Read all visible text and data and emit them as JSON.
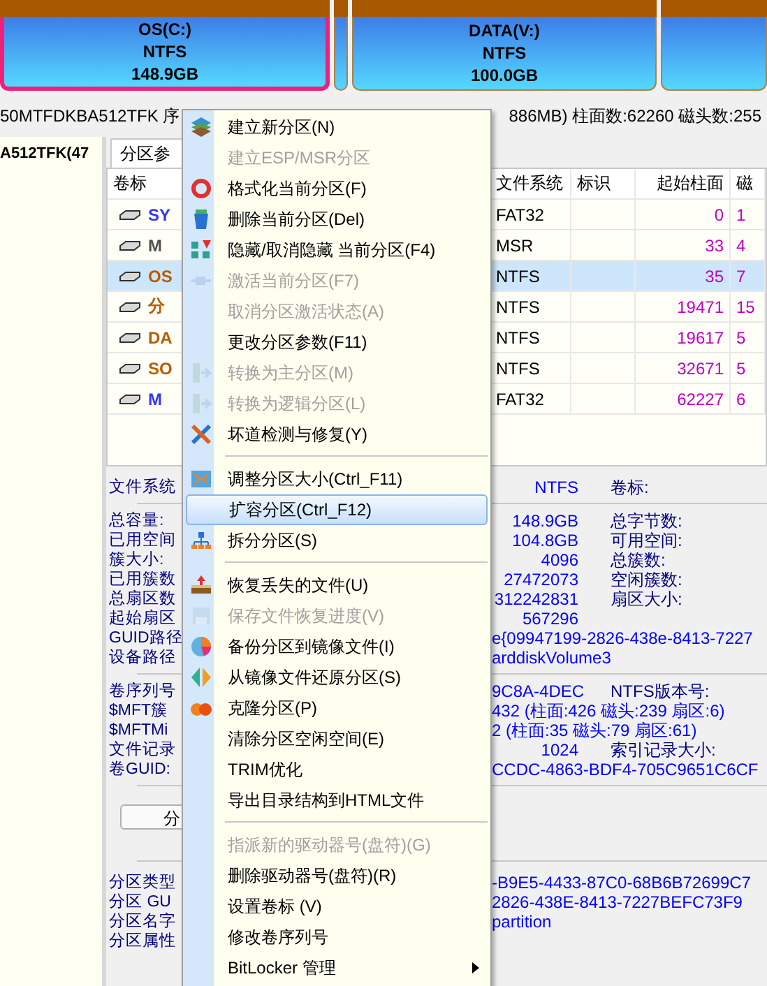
{
  "disk_map": {
    "partitions": [
      {
        "name": "OS(C:)",
        "fs": "NTFS",
        "size": "148.9GB",
        "selected": true,
        "kind": "large"
      },
      {
        "selected": false,
        "kind": "small"
      },
      {
        "name": "DATA(V:)",
        "fs": "NTFS",
        "size": "100.0GB",
        "selected": false,
        "kind": "large"
      },
      {
        "selected": false,
        "kind": "rest"
      }
    ]
  },
  "disk_info": {
    "left": "50MTFDKBA512TFK  序",
    "right": "886MB)  柱面数:62260  磁头数:255"
  },
  "disk_tree": {
    "item": "A512TFK(47"
  },
  "tabs": [
    {
      "label": "分区参",
      "selected": true
    }
  ],
  "table": {
    "columns": [
      "卷标",
      "文件系统",
      "标识",
      "起始柱面",
      "磁"
    ],
    "rows": [
      {
        "label": "SY",
        "color": "#3434ff",
        "fs": "FAT32",
        "start": "0",
        "column_5": "1",
        "selected": false
      },
      {
        "label": "M",
        "color": "#505050",
        "fs": "MSR",
        "start": "33",
        "column_5": "4",
        "selected": false
      },
      {
        "label": "OS",
        "color": "#b85c00",
        "fs": "NTFS",
        "start": "35",
        "column_5": "7",
        "selected": true
      },
      {
        "label": "分",
        "color": "#b85c00",
        "fs": "NTFS",
        "start": "19471",
        "column_5": "15",
        "selected": false
      },
      {
        "label": "DA",
        "color": "#b85c00",
        "fs": "NTFS",
        "start": "19617",
        "column_5": "5",
        "selected": false
      },
      {
        "label": "SO",
        "color": "#b85c00",
        "fs": "NTFS",
        "start": "32671",
        "column_5": "5",
        "selected": false
      },
      {
        "label": "M",
        "color": "#3434ff",
        "fs": "FAT32",
        "start": "62227",
        "column_5": "6",
        "selected": false
      }
    ]
  },
  "details": [
    [
      {
        "kind": "pair",
        "label": "文件系统",
        "value": "NTFS",
        "right_label": "卷标:"
      }
    ],
    [
      {
        "kind": "pair",
        "label": "总容量:",
        "value": "148.9GB",
        "right_label": "总字节数:"
      },
      {
        "kind": "pair",
        "label": "已用空间",
        "value": "104.8GB",
        "right_label": "可用空间:"
      },
      {
        "kind": "pair",
        "label": "簇大小:",
        "value": "4096",
        "right_label": "总簇数:"
      },
      {
        "kind": "pair",
        "label": "已用簇数",
        "value": "27472073",
        "right_label": "空闲簇数:"
      },
      {
        "kind": "pair",
        "label": "总扇区数",
        "value": "312242831",
        "right_label": "扇区大小:"
      },
      {
        "kind": "pair",
        "label": "起始扇区",
        "value": "567296"
      },
      {
        "kind": "long",
        "label": "GUID路径",
        "value": "e{09947199-2826-438e-8413-7227"
      },
      {
        "kind": "long",
        "label": "设备路径",
        "value": "arddiskVolume3"
      }
    ],
    [
      {
        "kind": "pair",
        "label": "卷序列号",
        "value": "9C8A-4DEC",
        "right_label": "NTFS版本号:"
      },
      {
        "kind": "long",
        "label": "$MFT簇",
        "value": "432 (柱面:426 磁头:239 扇区:6)"
      },
      {
        "kind": "long",
        "label": "$MFTMi",
        "value": "2 (柱面:35 磁头:79 扇区:61)"
      },
      {
        "kind": "pair",
        "label": "文件记录",
        "value": "1024",
        "right_label": "索引记录大小:"
      },
      {
        "kind": "long",
        "label": "卷GUID:",
        "value": "CCDC-4863-BDF4-705C9651C6CF"
      }
    ]
  ],
  "analyze_button": "分",
  "partition_info": [
    {
      "label": "分区类型",
      "value": "-B9E5-4433-87C0-68B6B72699C7"
    },
    {
      "label": "分区 GU",
      "value": "2826-438E-8413-7227BEFC73F9"
    },
    {
      "label": "分区名字",
      "value": "partition"
    },
    {
      "label": "分区属性"
    }
  ],
  "context_menu": [
    {
      "kind": "item",
      "label": "建立新分区(N)",
      "disabled": false,
      "selected": false
    },
    {
      "kind": "item",
      "label": "建立ESP/MSR分区",
      "disabled": true,
      "selected": false
    },
    {
      "kind": "item",
      "label": "格式化当前分区(F)",
      "disabled": false,
      "selected": false
    },
    {
      "kind": "item",
      "label": "删除当前分区(Del)",
      "disabled": false,
      "selected": false
    },
    {
      "kind": "item",
      "label": "隐藏/取消隐藏 当前分区(F4)",
      "disabled": false,
      "selected": false
    },
    {
      "kind": "item",
      "label": "激活当前分区(F7)",
      "disabled": true,
      "selected": false
    },
    {
      "kind": "item",
      "label": "取消分区激活状态(A)",
      "disabled": true,
      "selected": false
    },
    {
      "kind": "item",
      "label": "更改分区参数(F11)",
      "disabled": false,
      "selected": false
    },
    {
      "kind": "item",
      "label": "转换为主分区(M)",
      "disabled": true,
      "selected": false
    },
    {
      "kind": "item",
      "label": "转换为逻辑分区(L)",
      "disabled": true,
      "selected": false
    },
    {
      "kind": "item",
      "label": "坏道检测与修复(Y)",
      "disabled": false,
      "selected": false
    },
    {
      "kind": "separator"
    },
    {
      "kind": "item",
      "label": "调整分区大小(Ctrl_F11)",
      "disabled": false,
      "selected": false
    },
    {
      "kind": "item",
      "label": "扩容分区(Ctrl_F12)",
      "disabled": false,
      "selected": true
    },
    {
      "kind": "item",
      "label": "拆分分区(S)",
      "disabled": false,
      "selected": false
    },
    {
      "kind": "separator"
    },
    {
      "kind": "item",
      "label": "恢复丢失的文件(U)",
      "disabled": false,
      "selected": false
    },
    {
      "kind": "item",
      "label": "保存文件恢复进度(V)",
      "disabled": true,
      "selected": false
    },
    {
      "kind": "item",
      "label": "备份分区到镜像文件(I)",
      "disabled": false,
      "selected": false
    },
    {
      "kind": "item",
      "label": "从镜像文件还原分区(S)",
      "disabled": false,
      "selected": false
    },
    {
      "kind": "item",
      "label": "克隆分区(P)",
      "disabled": false,
      "selected": false
    },
    {
      "kind": "item",
      "label": "清除分区空闲空间(E)",
      "disabled": false,
      "selected": false
    },
    {
      "kind": "item",
      "label": "TRIM优化",
      "disabled": false,
      "selected": false
    },
    {
      "kind": "item",
      "label": "导出目录结构到HTML文件",
      "disabled": false,
      "selected": false
    },
    {
      "kind": "separator"
    },
    {
      "kind": "item",
      "label": "指派新的驱动器号(盘符)(G)",
      "disabled": true,
      "selected": false
    },
    {
      "kind": "item",
      "label": "删除驱动器号(盘符)(R)",
      "disabled": false,
      "selected": false
    },
    {
      "kind": "item",
      "label": "设置卷标 (V)",
      "disabled": false,
      "selected": false
    },
    {
      "kind": "item",
      "label": "修改卷序列号",
      "disabled": false,
      "selected": false
    },
    {
      "kind": "submenu",
      "label": "BitLocker 管理",
      "disabled": false,
      "selected": false
    }
  ]
}
